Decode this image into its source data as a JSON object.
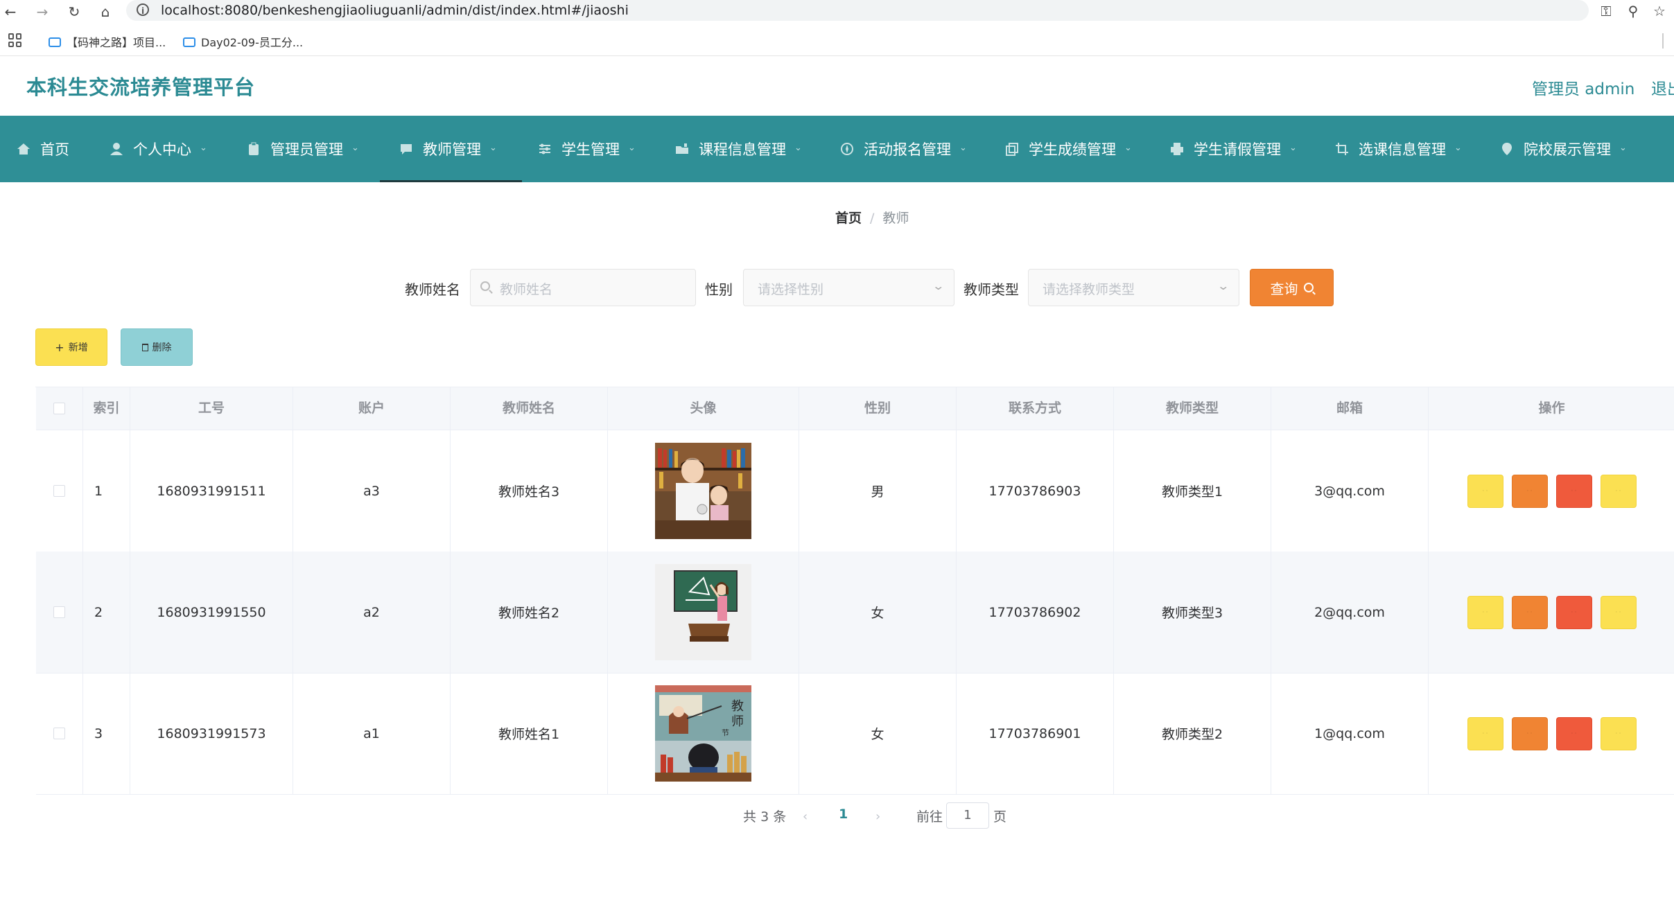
{
  "browser": {
    "url": "localhost:8080/benkeshengjiaoliuguanli/admin/dist/index.html#/jiaoshi",
    "bookmarks": [
      "【码神之路】项目...",
      "Day02-09-员工分..."
    ]
  },
  "header": {
    "title": "本科生交流培养管理平台",
    "admin_label": "管理员 admin",
    "logout": "退出"
  },
  "nav": {
    "active": "教师管理",
    "items": [
      {
        "label": "首页",
        "icon": "home-icon"
      },
      {
        "label": "个人中心",
        "icon": "user-icon"
      },
      {
        "label": "管理员管理",
        "icon": "clipboard-icon"
      },
      {
        "label": "教师管理",
        "icon": "chat-icon"
      },
      {
        "label": "学生管理",
        "icon": "sliders-icon"
      },
      {
        "label": "课程信息管理",
        "icon": "folder-icon"
      },
      {
        "label": "活动报名管理",
        "icon": "compass-icon"
      },
      {
        "label": "学生成绩管理",
        "icon": "copy-icon"
      },
      {
        "label": "学生请假管理",
        "icon": "printer-icon"
      },
      {
        "label": "选课信息管理",
        "icon": "crop-icon"
      },
      {
        "label": "院校展示管理",
        "icon": "location-icon"
      }
    ]
  },
  "breadcrumb": {
    "home": "首页",
    "separator": "/",
    "current": "教师"
  },
  "search": {
    "name_label": "教师姓名",
    "name_placeholder": "教师姓名",
    "gender_label": "性别",
    "gender_placeholder": "请选择性别",
    "type_label": "教师类型",
    "type_placeholder": "请选择教师类型",
    "query_button": "查询"
  },
  "actions": {
    "add": "新增",
    "delete": "删除"
  },
  "table": {
    "columns": [
      "索引",
      "工号",
      "账户",
      "教师姓名",
      "头像",
      "性别",
      "联系方式",
      "教师类型",
      "邮箱",
      "操作"
    ],
    "rows": [
      {
        "index": "1",
        "work_no": "1680931991511",
        "account": "a3",
        "name": "教师姓名3",
        "gender": "男",
        "phone": "17703786903",
        "type": "教师类型1",
        "email": "3@qq.com"
      },
      {
        "index": "2",
        "work_no": "1680931991550",
        "account": "a2",
        "name": "教师姓名2",
        "gender": "女",
        "phone": "17703786902",
        "type": "教师类型3",
        "email": "2@qq.com"
      },
      {
        "index": "3",
        "work_no": "1680931991573",
        "account": "a1",
        "name": "教师姓名1",
        "gender": "女",
        "phone": "17703786901",
        "type": "教师类型2",
        "email": "1@qq.com"
      }
    ]
  },
  "pagination": {
    "total_prefix": "共",
    "total": "3",
    "total_suffix": "条",
    "current_page": "1",
    "goto_label": "前往",
    "goto_value": "1",
    "page_suffix": "页"
  },
  "colors": {
    "primary": "#2f8f96",
    "title": "#2b8a93",
    "query": "#f08433",
    "add": "#fbe052",
    "delete": "#8fd0d6",
    "danger": "#ef5a3c"
  }
}
